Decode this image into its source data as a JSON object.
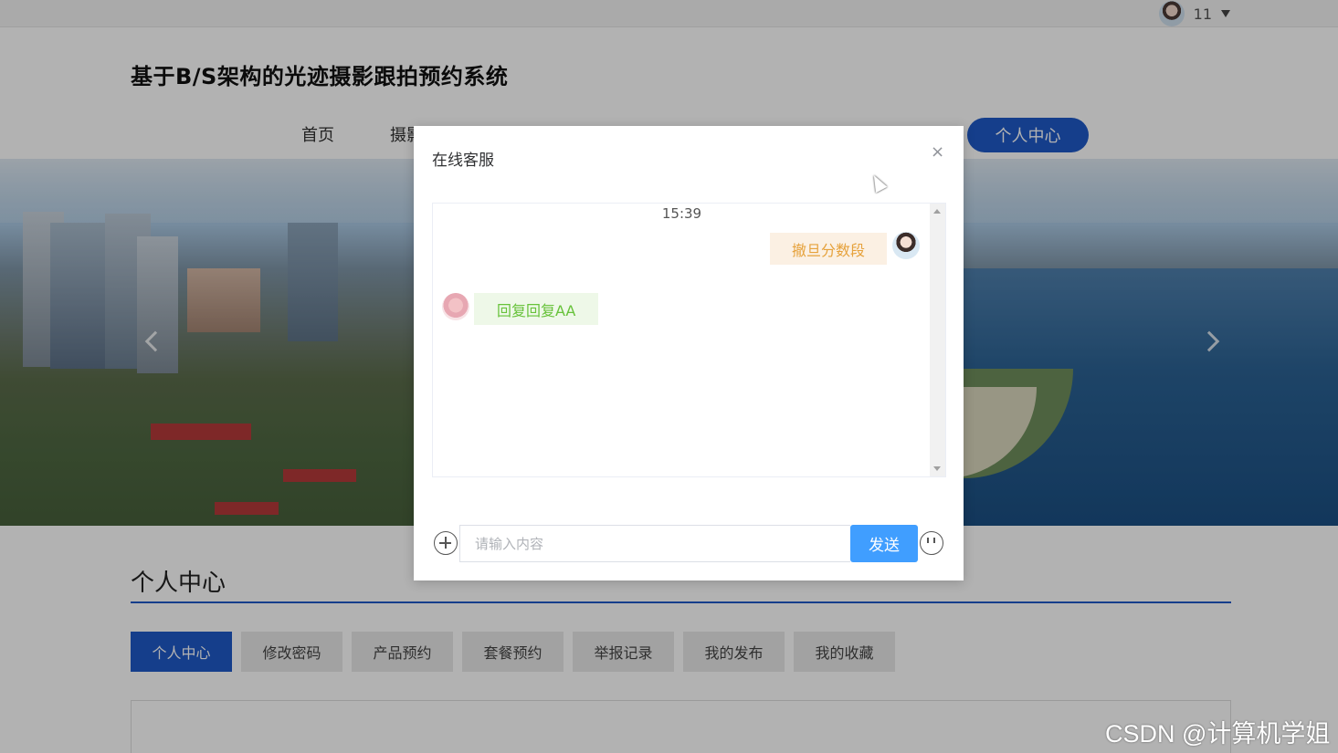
{
  "topbar": {
    "username": "11"
  },
  "header": {
    "site_title": "基于B/S架构的光迹摄影跟拍预约系统",
    "nav": {
      "home": "首页",
      "photo_partial": "摄影",
      "personal_center": "个人中心"
    }
  },
  "section": {
    "title": "个人中心",
    "tabs": [
      {
        "label": "个人中心",
        "active": true
      },
      {
        "label": "修改密码",
        "active": false
      },
      {
        "label": "产品预约",
        "active": false
      },
      {
        "label": "套餐预约",
        "active": false
      },
      {
        "label": "举报记录",
        "active": false
      },
      {
        "label": "我的发布",
        "active": false
      },
      {
        "label": "我的收藏",
        "active": false
      }
    ]
  },
  "modal": {
    "title": "在线客服",
    "close": "×",
    "chat": {
      "time": "15:39",
      "messages": [
        {
          "sender": "me",
          "text": "撤旦分数段"
        },
        {
          "sender": "service",
          "text": "回复回复AA"
        }
      ]
    },
    "input": {
      "placeholder": "请输入内容",
      "value": ""
    },
    "send_label": "发送"
  },
  "watermark": "CSDN @计算机学姐",
  "colors": {
    "accent": "#1f5ac8",
    "send_button": "#409eff",
    "my_bubble_text": "#e6a23c",
    "service_bubble_text": "#67c23a"
  },
  "icons": [
    "user-avatar-icon",
    "caret-down-icon",
    "close-icon",
    "plus-circle-icon",
    "emoji-icon",
    "banner-prev-icon",
    "banner-next-icon"
  ]
}
